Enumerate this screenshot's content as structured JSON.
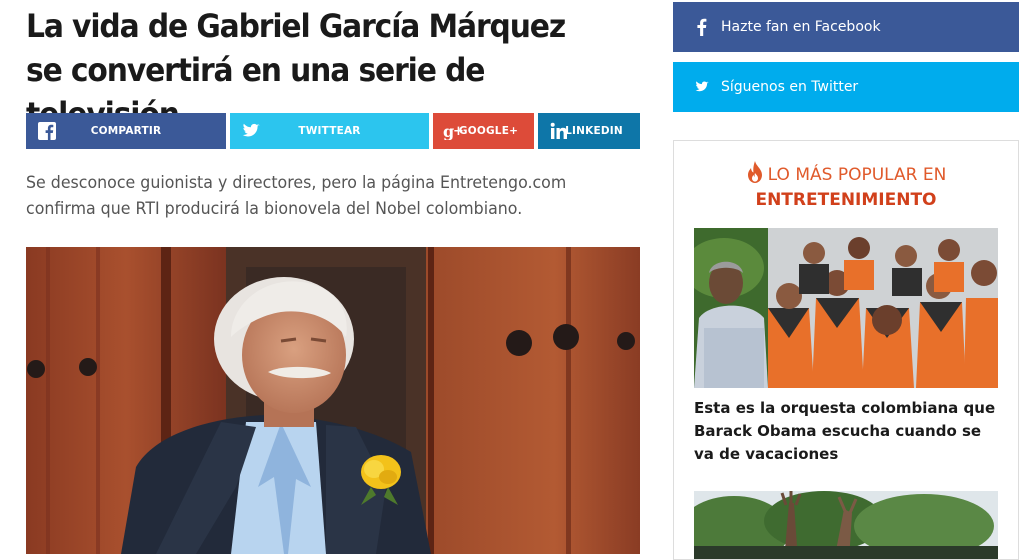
{
  "article": {
    "headline": "La vida de Gabriel García Márquez se convertirá en una serie de televisión",
    "dek": "Se desconoce guionista y directores, pero la página Entretengo.com confirma que RTI producirá la bionovela del Nobel colombiano."
  },
  "share_buttons": {
    "facebook": {
      "label": "COMPARTIR",
      "icon": "facebook-icon",
      "color": "#3b5998"
    },
    "twitter": {
      "label": "TWITTEAR",
      "icon": "twitter-icon",
      "color": "#2cc5ee"
    },
    "googleplus": {
      "label": "GOOGLE+",
      "icon": "google-plus-icon",
      "color": "#dd4b39"
    },
    "linkedin": {
      "label": "LINKEDIN",
      "icon": "linkedin-icon",
      "color": "#0e76a8"
    }
  },
  "sidebar": {
    "social": {
      "facebook": {
        "label": "Hazte fan en Facebook",
        "icon": "facebook-icon",
        "color": "#3b5998"
      },
      "twitter": {
        "label": "Síguenos en Twitter",
        "icon": "twitter-icon",
        "color": "#00aced"
      }
    },
    "popular": {
      "heading_line1": "LO MÁS POPULAR EN",
      "heading_line2": "ENTRETENIMIENTO",
      "icon": "flame-icon",
      "accent_color": "#e05a2b",
      "stories": [
        {
          "title": "Esta es la orquesta colombiana que Barack Obama escucha cuando se va de vacaciones"
        }
      ]
    }
  }
}
